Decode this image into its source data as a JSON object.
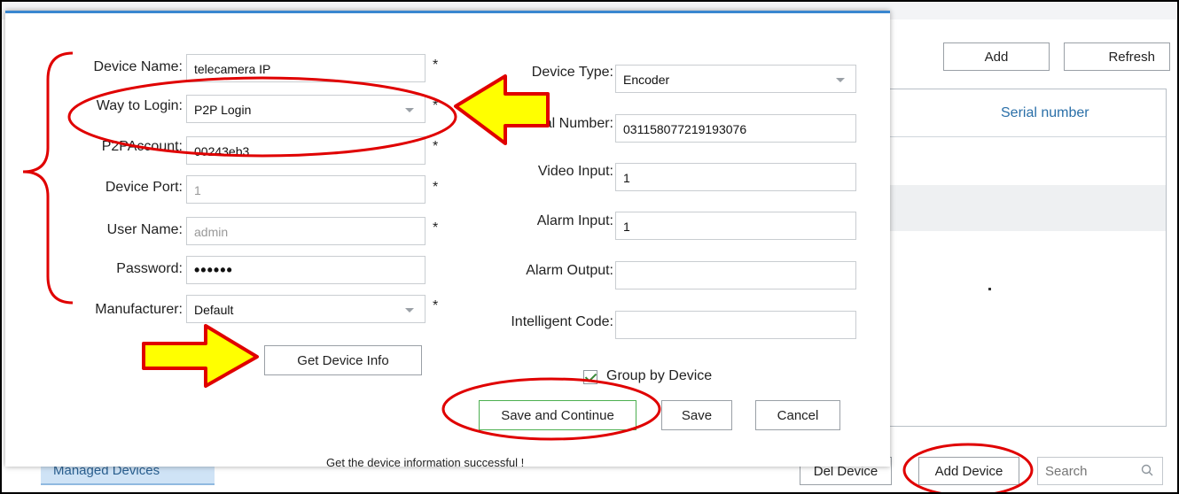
{
  "background": {
    "toolbar": {
      "add_label": "Add",
      "refresh_label": "Refresh"
    },
    "table": {
      "col_header": "Serial number",
      "row_marker": "."
    },
    "bottom": {
      "managed_devices_tab": "Managed Devices",
      "del_device_label": "Del Device",
      "add_device_label": "Add Device",
      "search_placeholder": "Search"
    }
  },
  "dialog": {
    "left": {
      "device_name": {
        "label": "Device Name:",
        "value": "telecamera IP",
        "required": "*"
      },
      "way_to_login": {
        "label": "Way to Login:",
        "value": "P2P Login",
        "required": "*"
      },
      "p2p_account": {
        "label": "P2PAccount:",
        "value": "00243eb3",
        "required": "*"
      },
      "device_port": {
        "label": "Device Port:",
        "value": "1",
        "required": "*"
      },
      "user_name": {
        "label": "User Name:",
        "value": "admin",
        "required": "*"
      },
      "password": {
        "label": "Password:",
        "value": "••••••"
      },
      "manufacturer": {
        "label": "Manufacturer:",
        "value": "Default",
        "required": "*"
      }
    },
    "right": {
      "device_type": {
        "label": "Device Type:",
        "value": "Encoder"
      },
      "serial_number": {
        "label": "Serial Number:",
        "value": "031158077219193076"
      },
      "video_input": {
        "label": "Video Input:",
        "value": "1"
      },
      "alarm_input": {
        "label": "Alarm Input:",
        "value": "1"
      },
      "alarm_output": {
        "label": "Alarm Output:",
        "value": ""
      },
      "intelligent_code": {
        "label": "Intelligent Code:",
        "value": ""
      }
    },
    "get_device_info_label": "Get Device Info",
    "group_by_device_label": "Group by Device",
    "group_by_device_checked": true,
    "save_continue_label": "Save and Continue",
    "save_label": "Save",
    "cancel_label": "Cancel",
    "status_message": "Get the device information successful !"
  },
  "annotations": {
    "color": "#e00000",
    "arrow_fill": "#ffff00"
  }
}
